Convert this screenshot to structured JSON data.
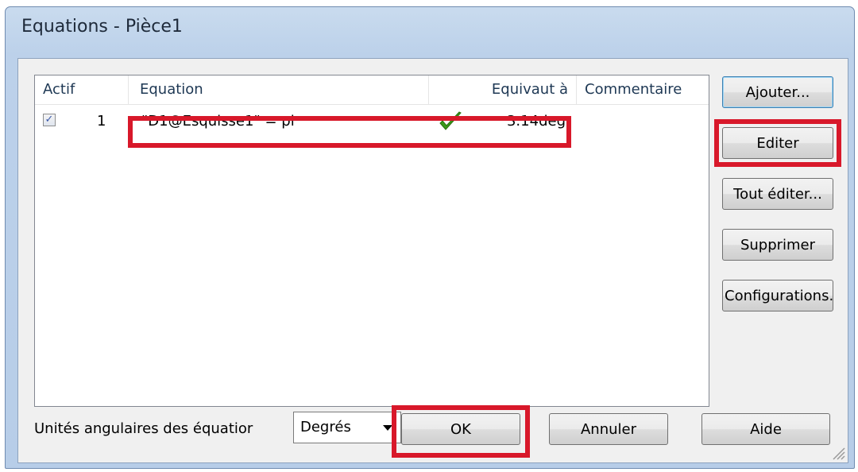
{
  "window": {
    "title": "Equations - Pièce1"
  },
  "table": {
    "headers": {
      "actif": "Actif",
      "equation": "Equation",
      "equivaut": "Equivaut à",
      "commentaire": "Commentaire"
    },
    "rows": [
      {
        "checked": true,
        "index": "1",
        "equation": "\"D1@Esquisse1\" =  pi",
        "status_icon": "green-checkmark-icon",
        "value": "3.14deg",
        "comment": ""
      }
    ]
  },
  "side_buttons": {
    "ajouter": "Ajouter...",
    "editer": "Editer",
    "tout_editer": "Tout éditer...",
    "supprimer": "Supprimer",
    "configurations": "Configurations."
  },
  "footer": {
    "units_label": "Unités angulaires des équatior",
    "units_value": "Degrés",
    "ok": "OK",
    "annuler": "Annuler",
    "aide": "Aide"
  },
  "colors": {
    "highlight": "#d8182a",
    "check": "#3a9a1a"
  }
}
